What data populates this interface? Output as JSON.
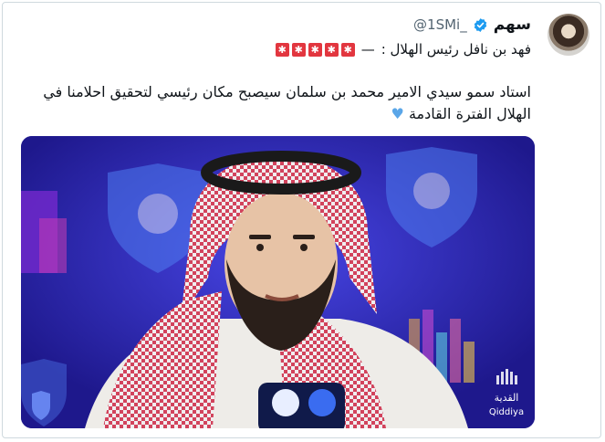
{
  "tweet": {
    "author_name": "سهم",
    "handle": "@1SMi_",
    "line1_text": "فهد بن نافل رئيس الهلال :",
    "line1_dash": "—",
    "sirens": [
      "🚨",
      "🚨",
      "🚨",
      "🚨",
      "🚨"
    ],
    "body_text": "استاد سمو سيدي الامير محمد بن سلمان سيصبح مكان رئيسي لتحقيق احلامنا في الهلال الفترة القادمة",
    "body_emoji": "💙",
    "media": {
      "watermark_ar": "القدية",
      "watermark_en": "Qiddiya"
    }
  },
  "icons": {
    "verified": "verified-badge-icon",
    "siren": "police-siren-icon",
    "heart": "blue-heart-icon",
    "club_logo": "al-hilal-logo-icon"
  },
  "colors": {
    "border": "#cfd9de",
    "handle": "#536471",
    "verified": "#1d9bf0",
    "media_bg": "#2b27b8",
    "siren": "#e2363f"
  }
}
